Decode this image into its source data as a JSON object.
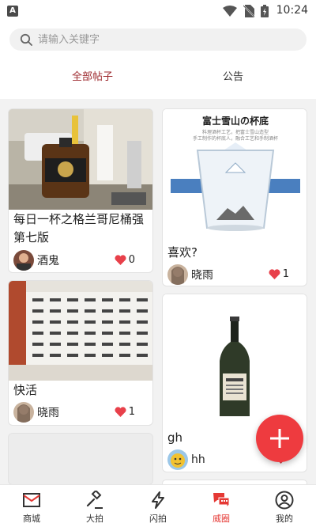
{
  "status_bar": {
    "time": "10:24",
    "app_icon_letter": "A",
    "icons": [
      "wifi-icon",
      "no-sim-icon",
      "battery-icon"
    ]
  },
  "search": {
    "placeholder": "请输入关键字",
    "icon": "search-icon"
  },
  "tabs": [
    {
      "label": "全部帖子",
      "active": true
    },
    {
      "label": "公告",
      "active": false
    }
  ],
  "posts_left": [
    {
      "title": "每日一杯之格兰哥尼桶强第七版",
      "user": "酒鬼",
      "likes": "0",
      "image": "whisky-bottle-photo"
    },
    {
      "title": "快活",
      "user": "晓雨",
      "likes": "1",
      "image": "event-backdrop-photo"
    },
    {
      "title": "",
      "user": "",
      "likes": "",
      "image": "blank-photo"
    }
  ],
  "posts_right": [
    {
      "title": "喜欢?",
      "user": "晓雨",
      "likes": "1",
      "image": "fuji-glass-photo",
      "image_caption": "富士雪山の杯底",
      "image_subcaption_1": "料理酒杯工艺，把富士雪山造型",
      "image_subcaption_2": "手工制作的杯底人，融合工艺和手制酒杯"
    },
    {
      "title": "gh",
      "user": "hh",
      "likes": "",
      "image": "dark-bottle-photo"
    }
  ],
  "fab": {
    "icon": "plus-icon"
  },
  "bottom_nav": [
    {
      "label": "商城",
      "icon": "mail-icon",
      "active": false
    },
    {
      "label": "大拍",
      "icon": "gavel-icon",
      "active": false
    },
    {
      "label": "闪拍",
      "icon": "lightning-icon",
      "active": false
    },
    {
      "label": "威圈",
      "icon": "chat-bubbles-icon",
      "active": true
    },
    {
      "label": "我的",
      "icon": "user-icon",
      "active": false
    }
  ],
  "colors": {
    "accent_red": "#ee3b3f",
    "tab_active": "#9e2b30",
    "heart": "#e8404a",
    "nav_active": "#e53935"
  }
}
